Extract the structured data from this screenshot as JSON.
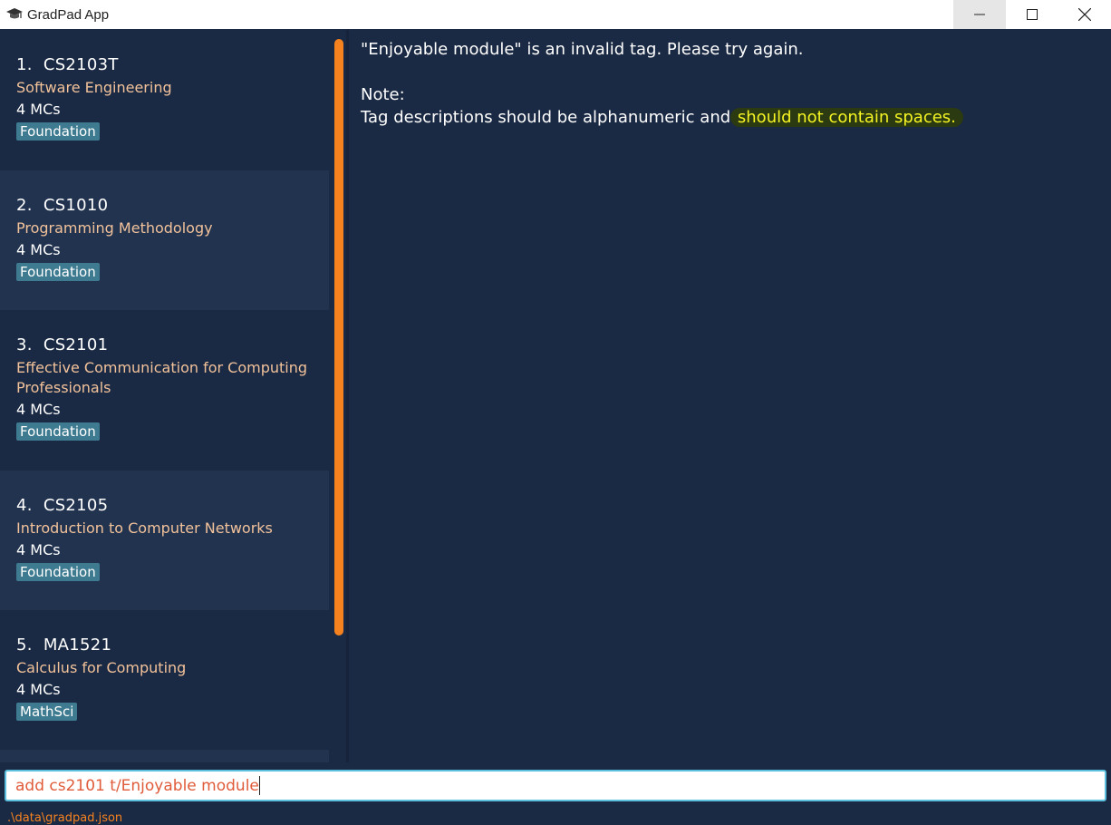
{
  "window": {
    "title": "GradPad App",
    "icon": "graduation-cap-icon",
    "controls": [
      "minimize-icon",
      "maximize-icon",
      "close-icon"
    ]
  },
  "modules": [
    {
      "index": "1.",
      "code": "CS2103T",
      "title": "Software Engineering",
      "mcs": "4 MCs",
      "tag": "Foundation"
    },
    {
      "index": "2.",
      "code": "CS1010",
      "title": "Programming Methodology",
      "mcs": "4 MCs",
      "tag": "Foundation"
    },
    {
      "index": "3.",
      "code": "CS2101",
      "title": "Effective Communication for Computing Professionals",
      "mcs": "4 MCs",
      "tag": "Foundation"
    },
    {
      "index": "4.",
      "code": "CS2105",
      "title": "Introduction to Computer Networks",
      "mcs": "4 MCs",
      "tag": "Foundation"
    },
    {
      "index": "5.",
      "code": "MA1521",
      "title": "Calculus for Computing",
      "mcs": "4 MCs",
      "tag": "MathSci"
    }
  ],
  "result": {
    "error": "\"Enjoyable module\" is an invalid tag. Please try again.",
    "note_label": "Note:",
    "note_text": "Tag descriptions should be alphanumeric and ",
    "note_highlight": "should not contain spaces."
  },
  "command": {
    "value": "add cs2101 t/Enjoyable module"
  },
  "status_bar": {
    "path": ".\\data\\gradpad.json"
  },
  "colors": {
    "background": "#1b2a44",
    "card_alt": "#223350",
    "accent": "#f5821f",
    "tag": "#3e7b91",
    "title_text": "#f2c29a",
    "highlight_text": "#f5f523",
    "command_text": "#e05b3a"
  }
}
